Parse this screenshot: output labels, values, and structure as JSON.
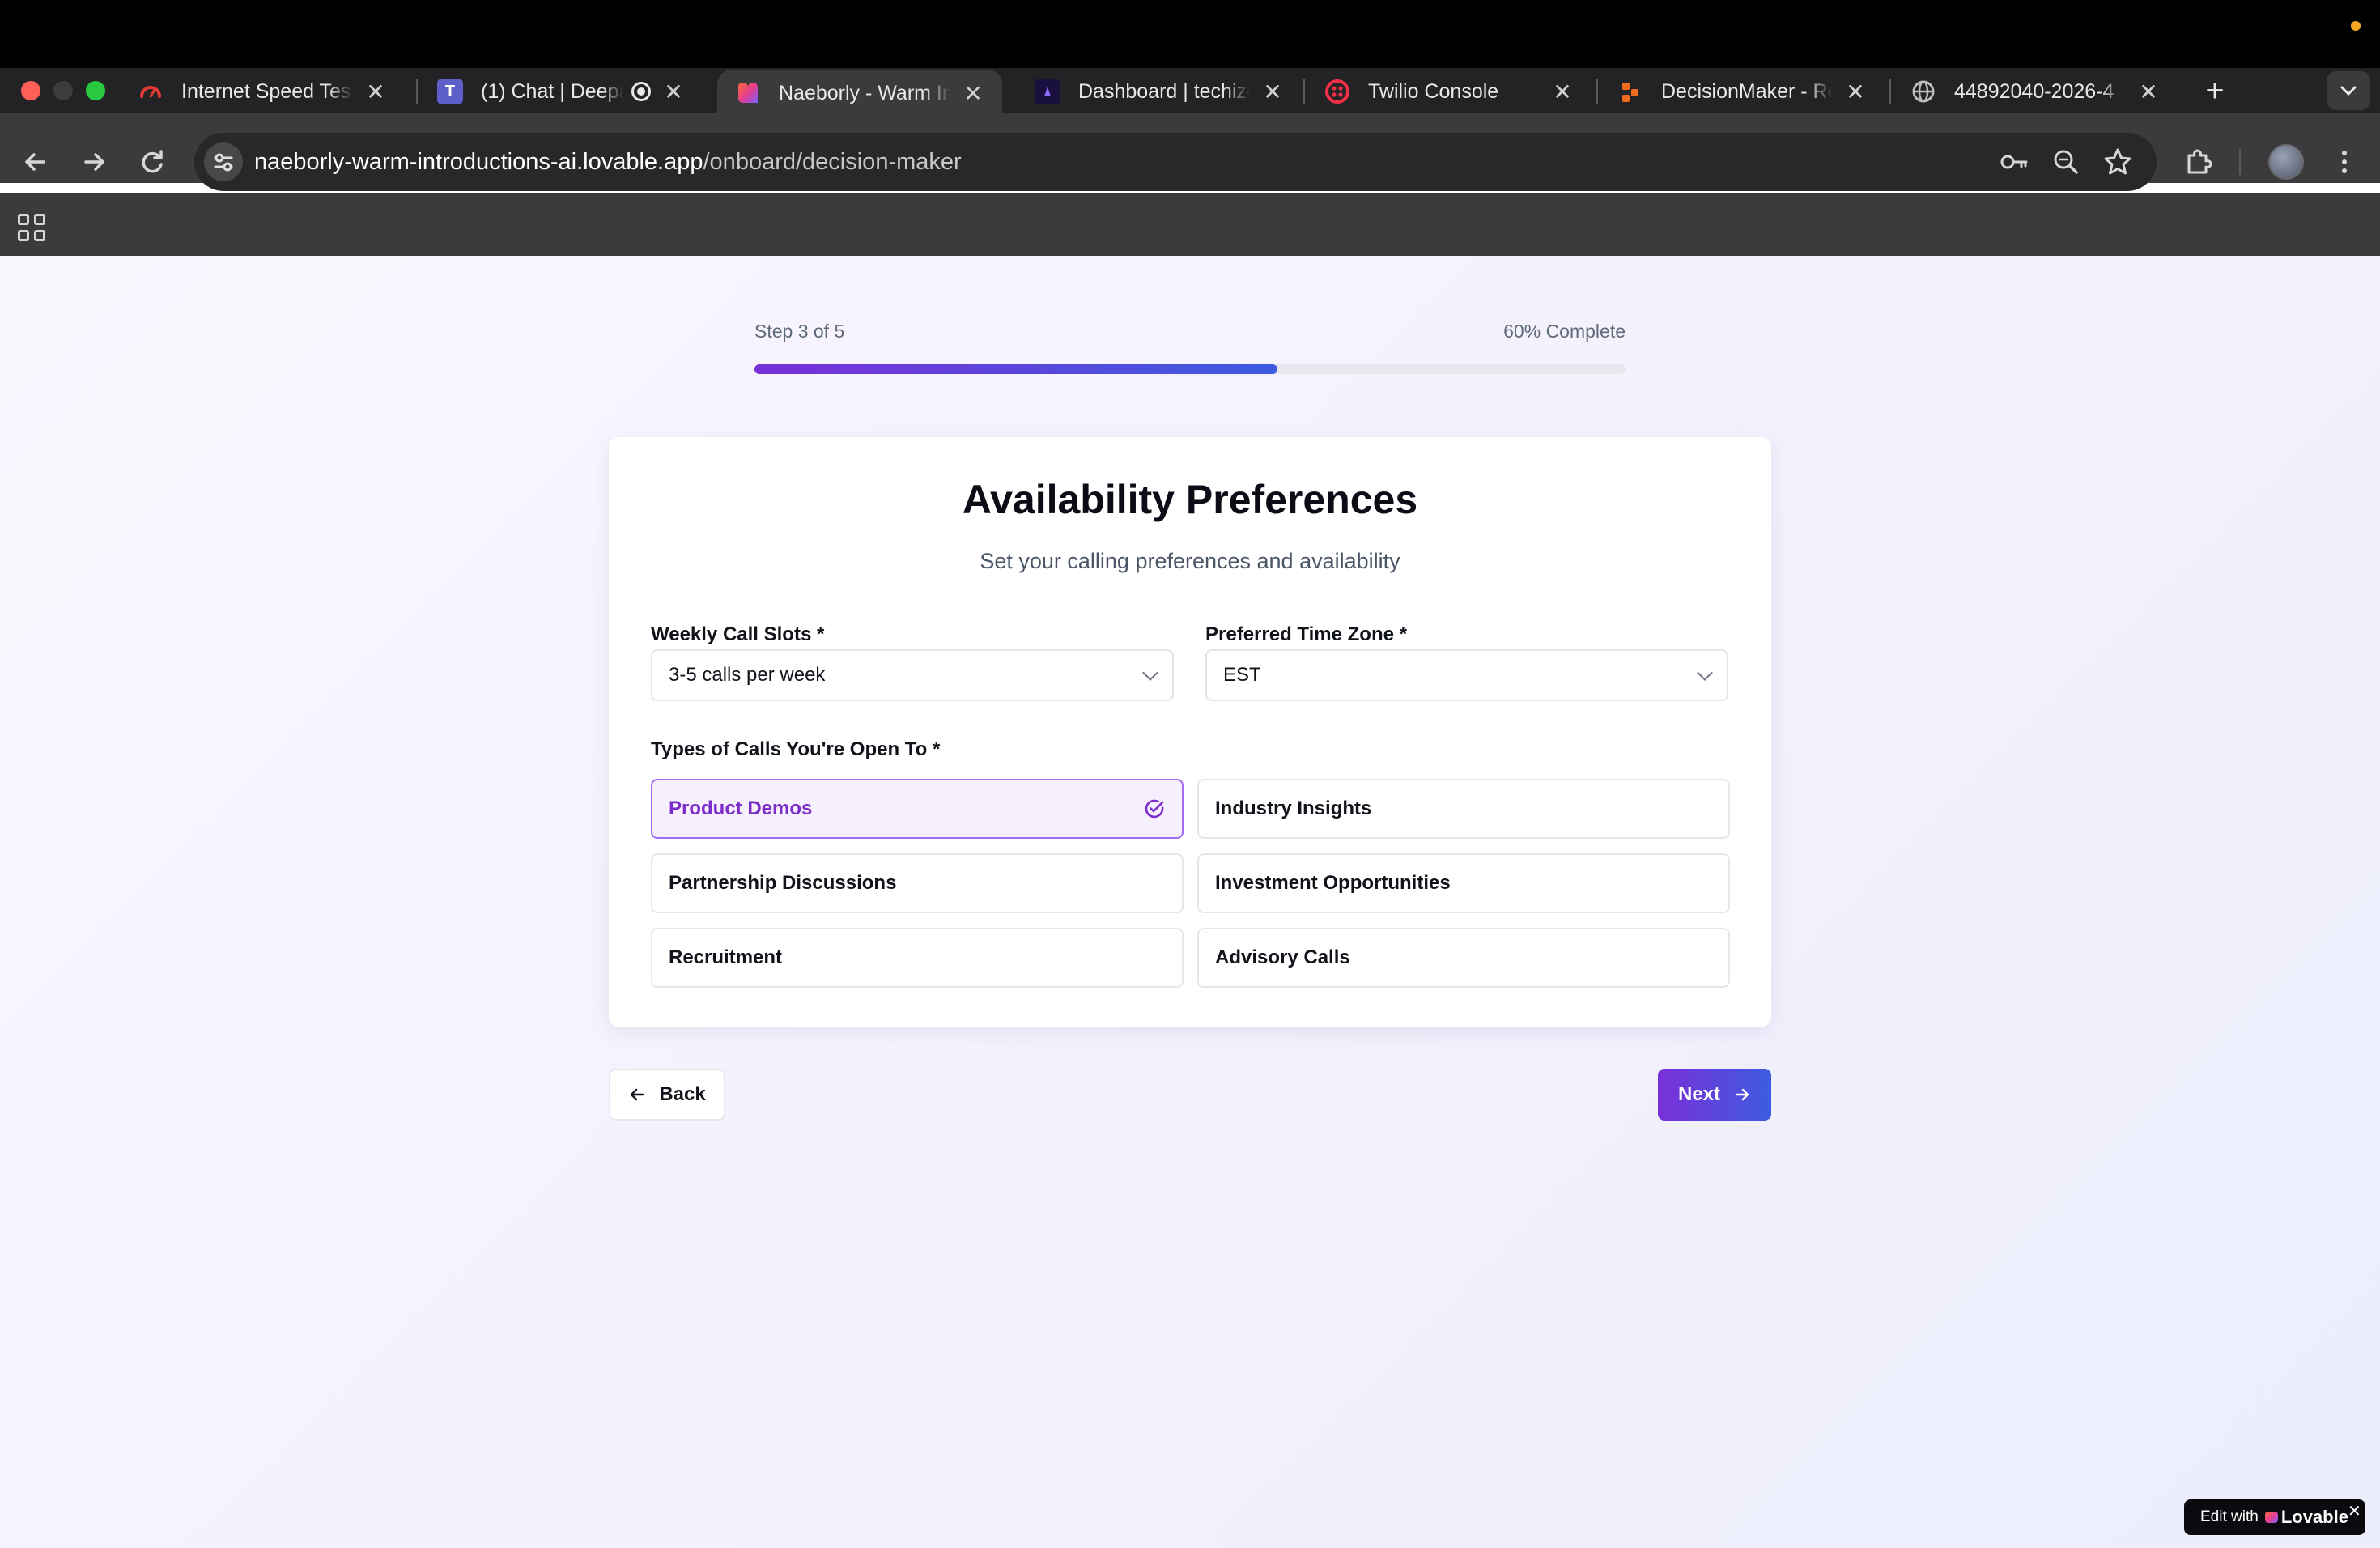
{
  "browser": {
    "tabs": [
      {
        "title": "Internet Speed Test",
        "favicon": "speedometer-icon",
        "favicon_color": "#e53935",
        "active": false
      },
      {
        "title": "(1) Chat | Deepa",
        "favicon": "teams-icon",
        "favicon_color": "#5b5fc7",
        "active": false,
        "recording": true
      },
      {
        "title": "Naeborly - Warm In",
        "favicon": "lovable-heart-icon",
        "favicon_color": "#e83e8c",
        "active": true
      },
      {
        "title": "Dashboard | techize",
        "favicon": "dashboard-icon",
        "favicon_color": "#1a1040",
        "active": false
      },
      {
        "title": "Twilio Console",
        "favicon": "twilio-icon",
        "favicon_color": "#f22f46",
        "active": false
      },
      {
        "title": "DecisionMaker - Re",
        "favicon": "decisionmaker-icon",
        "favicon_color": "#f26b1d",
        "active": false
      },
      {
        "title": "44892040-2026-4",
        "favicon": "globe-icon",
        "favicon_color": "#bdbdbd",
        "active": false
      }
    ],
    "url_host": "naeborly-warm-introductions-ai.lovable.app",
    "url_path": "/onboard/decision-maker"
  },
  "progress": {
    "step_text": "Step 3 of 5",
    "complete_text": "60% Complete",
    "fraction": 0.6
  },
  "card": {
    "title": "Availability Preferences",
    "subtitle": "Set your calling preferences and availability"
  },
  "form": {
    "weekly_slots_label": "Weekly Call Slots *",
    "weekly_slots_value": "3-5 calls per week",
    "timezone_label": "Preferred Time Zone *",
    "timezone_value": "EST",
    "call_types_label": "Types of Calls You're Open To *",
    "call_types": [
      {
        "label": "Product Demos",
        "selected": true
      },
      {
        "label": "Industry Insights",
        "selected": false
      },
      {
        "label": "Partnership Discussions",
        "selected": false
      },
      {
        "label": "Investment Opportunities",
        "selected": false
      },
      {
        "label": "Recruitment",
        "selected": false
      },
      {
        "label": "Advisory Calls",
        "selected": false
      }
    ]
  },
  "buttons": {
    "back_label": "Back",
    "next_label": "Next"
  },
  "badge": {
    "prefix": "Edit with",
    "brand": "Lovable",
    "close": "✕"
  },
  "colors": {
    "accent_purple": "#7a30d8",
    "accent_blue": "#3d5be0",
    "selected_text": "#7b2cc9"
  }
}
